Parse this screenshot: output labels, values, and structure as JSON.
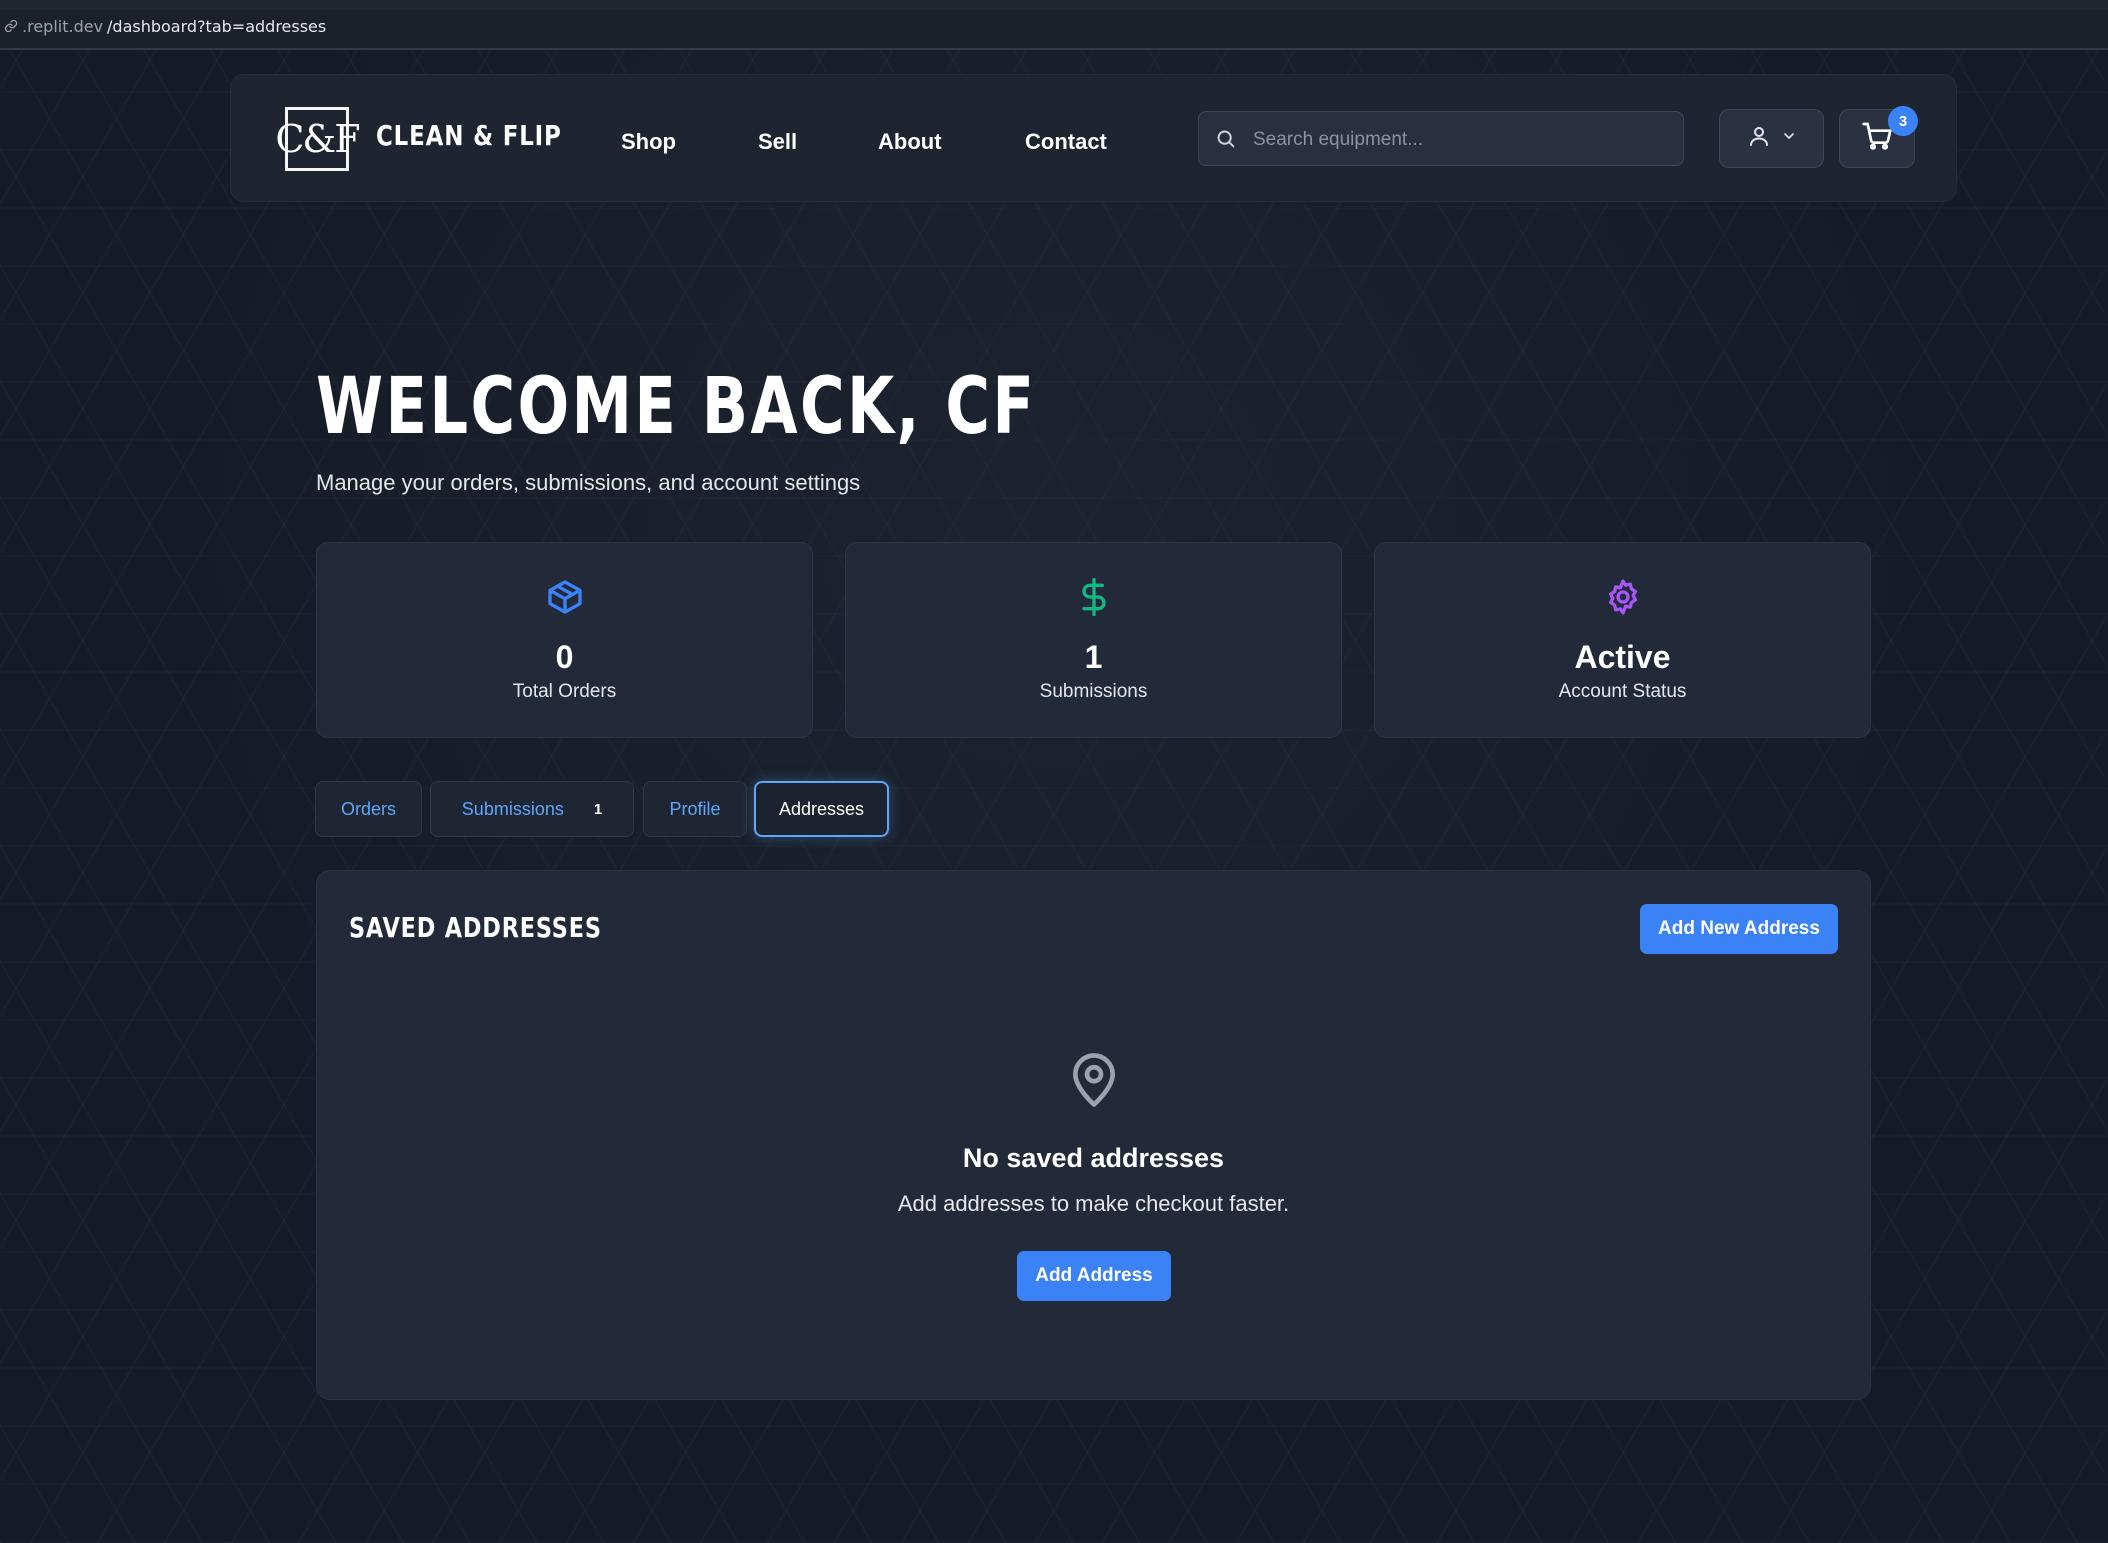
{
  "browser": {
    "url_host": ".replit.dev",
    "url_path": "/dashboard?tab=addresses"
  },
  "header": {
    "logo_text": "C&F",
    "brand_name": "CLEAN & FLIP",
    "nav": [
      "Shop",
      "Sell",
      "About",
      "Contact"
    ],
    "search_placeholder": "Search equipment...",
    "user_icon": "user-icon",
    "cart_icon": "shopping-cart-icon",
    "cart_count": "3"
  },
  "welcome": {
    "title": "WELCOME BACK, CF",
    "subtitle": "Manage your orders, submissions, and account settings"
  },
  "stats": [
    {
      "icon": "package-icon",
      "value": "0",
      "label": "Total Orders",
      "color": "#3b82f6"
    },
    {
      "icon": "dollar-icon",
      "value": "1",
      "label": "Submissions",
      "color": "#10b981"
    },
    {
      "icon": "gear-icon",
      "value": "Active",
      "label": "Account Status",
      "color": "#a855f7"
    }
  ],
  "tabs": [
    {
      "label": "Orders"
    },
    {
      "label": "Submissions",
      "count": "1"
    },
    {
      "label": "Profile"
    },
    {
      "label": "Addresses",
      "active": true
    }
  ],
  "addresses": {
    "title": "SAVED ADDRESSES",
    "add_new_label": "Add New Address",
    "empty_icon": "map-pin-icon",
    "empty_title": "No saved addresses",
    "empty_description": "Add addresses to make checkout faster.",
    "add_label": "Add Address"
  },
  "colors": {
    "accent": "#3b82f6",
    "background": "#161c27",
    "card": "#222938"
  }
}
